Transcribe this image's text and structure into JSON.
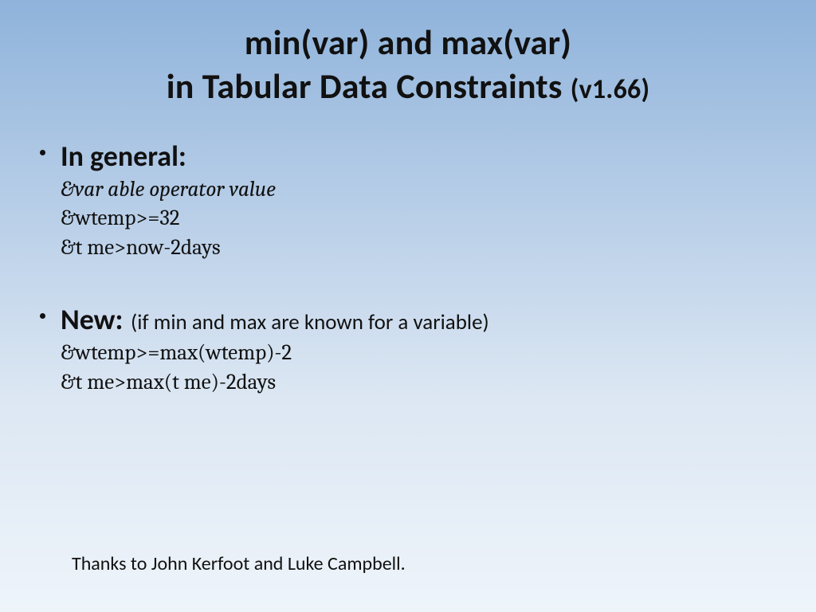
{
  "title": {
    "line1": "min(var) and max(var)",
    "line2_main": "in Tabular Data Constraints",
    "line2_version": "(v1.66)"
  },
  "bullets": [
    {
      "lead": "In general:",
      "lead_note": "",
      "lines": [
        {
          "text": "&var able operator value",
          "italic": true
        },
        {
          "text": "&wtemp>=32",
          "italic": false
        },
        {
          "text": "&t me>now-2days",
          "italic": false
        }
      ]
    },
    {
      "lead": "New:",
      "lead_note": "(if min and max are known for a variable)",
      "lines": [
        {
          "text": "&wtemp>=max(wtemp)-2",
          "italic": false
        },
        {
          "text": "&t me>max(t me)-2days",
          "italic": false
        }
      ]
    }
  ],
  "footer": "Thanks to John Kerfoot and Luke Campbell."
}
